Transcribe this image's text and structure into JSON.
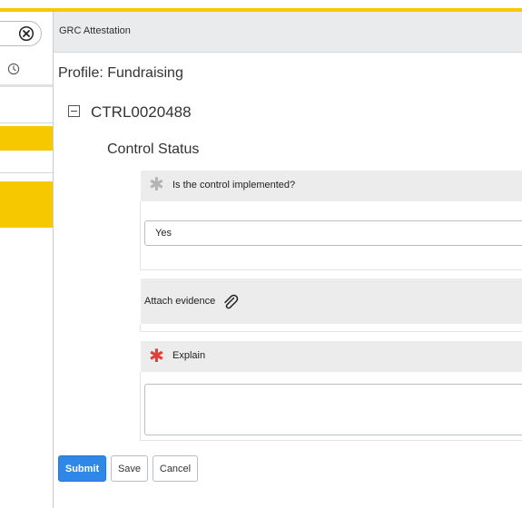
{
  "header": {
    "title": "GRC Attestation"
  },
  "nav": {
    "clear_icon": "close-circle-icon",
    "history_icon": "clock-icon"
  },
  "form": {
    "profile_title": "Profile: Fundraising",
    "control_id": "CTRL0020488",
    "section_title": "Control Status",
    "question_implemented": {
      "label": "Is the control implemented?",
      "value": "Yes"
    },
    "attach_evidence": {
      "label": "Attach evidence",
      "icon": "paperclip-icon"
    },
    "explain": {
      "label": "Explain",
      "value": ""
    }
  },
  "actions": {
    "submit_label": "Submit",
    "save_label": "Save",
    "cancel_label": "Cancel"
  },
  "colors": {
    "accent_yellow": "#f5c800",
    "primary_blue": "#2f88e8",
    "required_red": "#e0403a"
  }
}
